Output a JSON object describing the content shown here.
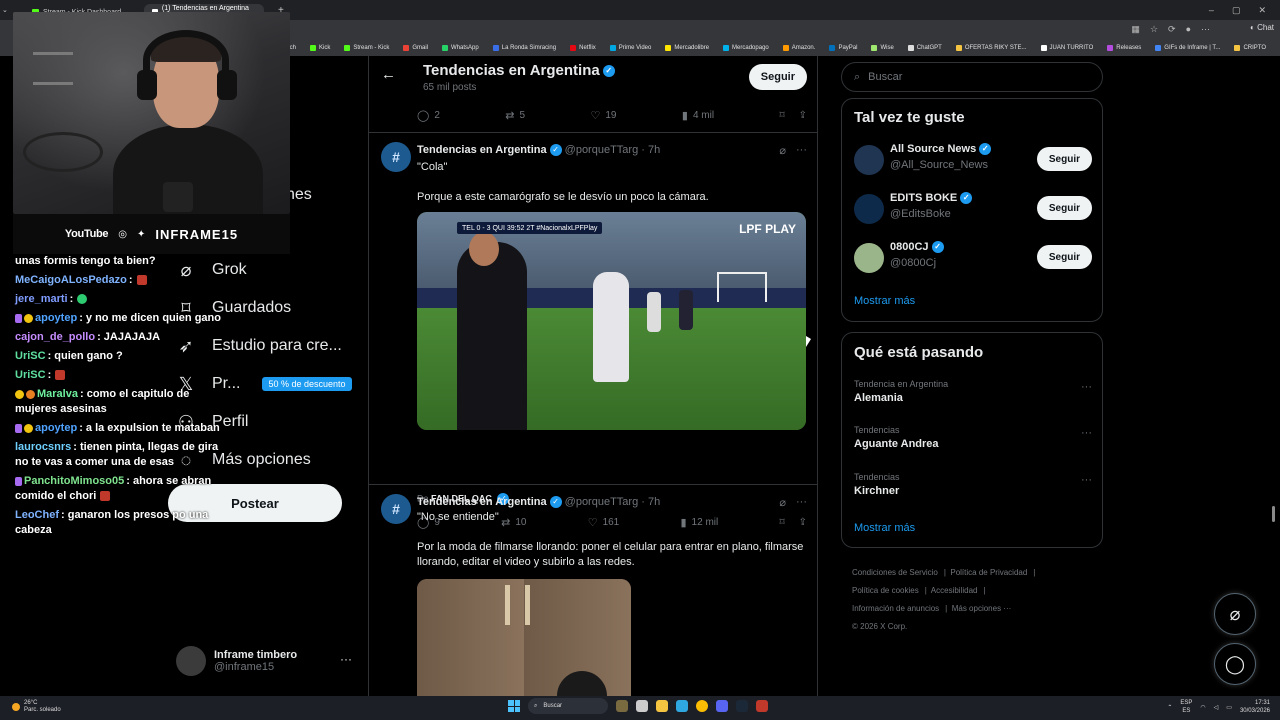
{
  "browser": {
    "tabs": [
      {
        "title": "Stream - Kick Dashboard"
      },
      {
        "title": "(1) Tendencias en Argentina (@po..."
      }
    ],
    "new_tab": "+",
    "bookmarks": [
      "...itch",
      "Kick",
      "Stream - Kick",
      "Gmail",
      "WhatsApp",
      "La Ronda Simracing",
      "Netflix",
      "Prime Video",
      "Mercadolibre",
      "Mercadopago",
      "Amazon.",
      "PayPal",
      "Wise",
      "ChatGPT",
      "OFERTAS RIKY STE...",
      "JUAN TURRITO",
      "Releases",
      "GIFs de Inframe | T...",
      "CRIPTO"
    ],
    "copilot_label": "Chat"
  },
  "webcam": {
    "youtube_label": "YouTube",
    "handle": "INFRAME15"
  },
  "nav": {
    "partial_label": "nes",
    "grok": "Grok",
    "guardados": "Guardados",
    "estudio": "Estudio para cre...",
    "premium": "Pr...",
    "premium_badge": "50 % de descuento",
    "perfil": "Perfil",
    "mas": "Más opciones",
    "post_button": "Postear"
  },
  "account": {
    "name": "Inframe timbero",
    "handle": "@inframe15"
  },
  "chat": {
    "messages": [
      {
        "user": "",
        "text": "unas formis tengo ta bien?"
      },
      {
        "user": "MeCaigoALosPedazo",
        "text": ":"
      },
      {
        "user": "jere_marti",
        "text": ":"
      },
      {
        "user": "apoytep",
        "text": ": y no me dicen quien gano"
      },
      {
        "user": "cajon_de_pollo",
        "text": ": JAJAJAJA"
      },
      {
        "user": "UriSC",
        "text": ": quien gano ?"
      },
      {
        "user": "UriSC",
        "text": ":"
      },
      {
        "user": "Maralva",
        "text": ": como el capitulo de mujeres asesinas"
      },
      {
        "user": "apoytep",
        "text": ": a la expulsion te mataban"
      },
      {
        "user": "laurocsnrs",
        "text": ": tienen pinta, llegas de gira no te vas a comer una de esas"
      },
      {
        "user": "PanchitoMimoso05",
        "text": ": ahora se abran comido el chori"
      },
      {
        "user": "LeoChef",
        "text": ": ganaron los presos po una cabeza"
      }
    ],
    "colors": {
      "MeCaigoALosPedazo": "#7fb3ff",
      "jere_marti": "#7f9cff",
      "apoytep": "#4fa3ff",
      "cajon_de_pollo": "#c58cff",
      "UriSC": "#5fe0a0",
      "Maralva": "#6ff0a0",
      "laurocsnrs": "#6fd0ff",
      "PanchitoMimoso05": "#7fe38f",
      "LeoChef": "#7fb3ff"
    }
  },
  "feed": {
    "header_title": "Tendencias en Argentina",
    "header_sub": "65 mil posts",
    "follow_label": "Seguir",
    "top_actions": {
      "replies": "2",
      "reposts": "5",
      "likes": "19",
      "views": "4 mil"
    },
    "posts": [
      {
        "name": "Tendencias en Argentina",
        "handle": "@porqueTTarg",
        "time": "7h",
        "line1": "\"Cola\"",
        "line2": "Porque a este camarógrafo se le desvío un poco la cámara.",
        "scoreboard": "TEL 0 - 3 QUI  39:52 2T  #NacionalxLPFPlay",
        "watermark": "LPF PLAY",
        "from_prefix": "De",
        "from_name": "FAN DEL QAC",
        "actions": {
          "replies": "9",
          "reposts": "10",
          "likes": "161",
          "views": "12 mil"
        }
      },
      {
        "name": "Tendencias en Argentina",
        "handle": "@porqueTTarg",
        "time": "7h",
        "line1": "\"No se entiende\"",
        "line2": "Por la moda de filmarse llorando: poner el celular para entrar en plano, filmarse llorando, editar el video y subirlo a las redes."
      }
    ]
  },
  "sidebar": {
    "search_placeholder": "Buscar",
    "suggest_title": "Tal vez te guste",
    "suggestions": [
      {
        "name": "All Source News",
        "handle": "@All_Source_News",
        "button": "Seguir"
      },
      {
        "name": "EDITS BOKE",
        "handle": "@EditsBoke",
        "button": "Seguir"
      },
      {
        "name": "0800CJ",
        "handle": "@0800Cj",
        "button": "Seguir"
      }
    ],
    "show_more": "Mostrar más",
    "trends_title": "Qué está pasando",
    "trends": [
      {
        "context": "Tendencia en Argentina",
        "topic": "Alemania"
      },
      {
        "context": "Tendencias",
        "topic": "Aguante Andrea"
      },
      {
        "context": "Tendencias",
        "topic": "Kirchner"
      }
    ],
    "trends_show_more": "Mostrar más",
    "footer": {
      "terms": "Condiciones de Servicio",
      "privacy": "Política de Privacidad",
      "cookies": "Política de cookies",
      "accessibility": "Accesibilidad",
      "ads": "Información de anuncios",
      "more": "Más opciones ···",
      "copyright": "© 2026 X Corp."
    }
  },
  "taskbar": {
    "temp": "26°C",
    "weather": "Parc. soleado",
    "search": "Buscar",
    "lang1": "ESP",
    "lang2": "ES",
    "time": "17:31",
    "date": "30/03/2026"
  },
  "colors": {
    "accent": "#1d9bf0",
    "kick_green": "#53fc18"
  }
}
